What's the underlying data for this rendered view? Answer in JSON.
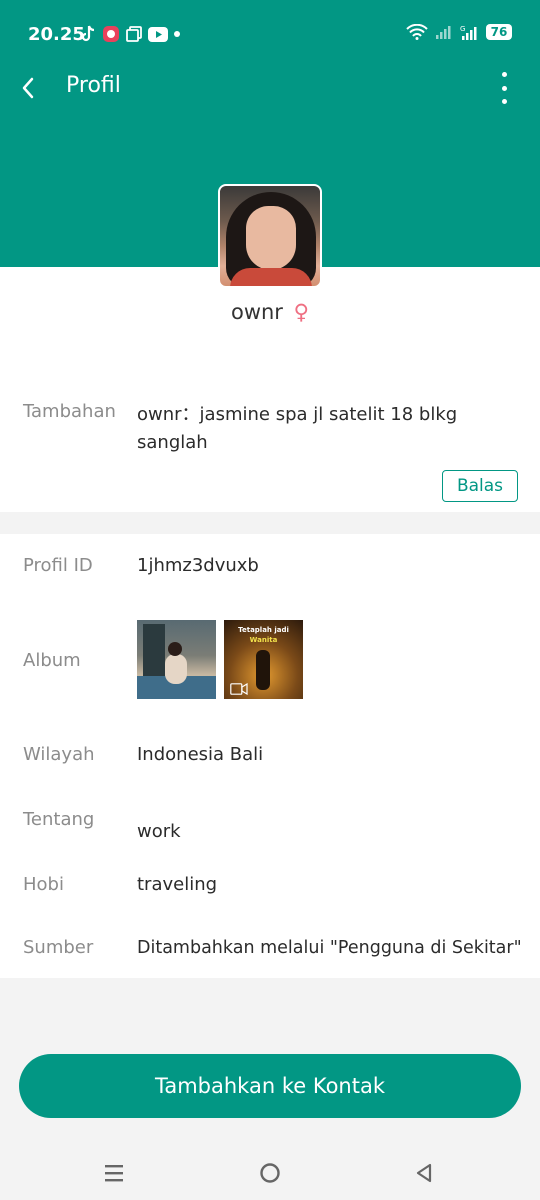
{
  "status_bar": {
    "time": "20.25",
    "battery": "76",
    "icons": [
      "tiktok-icon",
      "app-icon",
      "copy-icon",
      "youtube-icon",
      "dot-icon",
      "wifi-icon",
      "signal-icon",
      "signal-g-icon",
      "battery-icon"
    ]
  },
  "appbar": {
    "title": "Profil",
    "back_icon": "chevron-left-icon",
    "more_icon": "more-vertical-icon"
  },
  "profile": {
    "name": "ownr",
    "gender_symbol": "♀"
  },
  "extra": {
    "label": "Tambahan",
    "value": "ownr：jasmine spa jl satelit 18 blkg sanglah",
    "reply_button": "Balas"
  },
  "details": {
    "profile_id_label": "Profil ID",
    "profile_id_value": "1jhmz3dvuxb",
    "album_label": "Album",
    "album_thumb2_text1": "Tetaplah jadi",
    "album_thumb2_text2": "Wanita",
    "region_label": "Wilayah",
    "region_value": "Indonesia Bali",
    "about_label": "Tentang",
    "about_value": "work",
    "hobby_label": "Hobi",
    "hobby_value": "traveling",
    "source_label": "Sumber",
    "source_value": "Ditambahkan melalui \"Pengguna di Sekitar\""
  },
  "actions": {
    "add_contact": "Tambahkan ke Kontak"
  },
  "navbar": {
    "icons": [
      "menu-icon",
      "home-circle-icon",
      "back-triangle-icon"
    ]
  },
  "colors": {
    "accent": "#029784",
    "gender": "#ef6f82"
  }
}
